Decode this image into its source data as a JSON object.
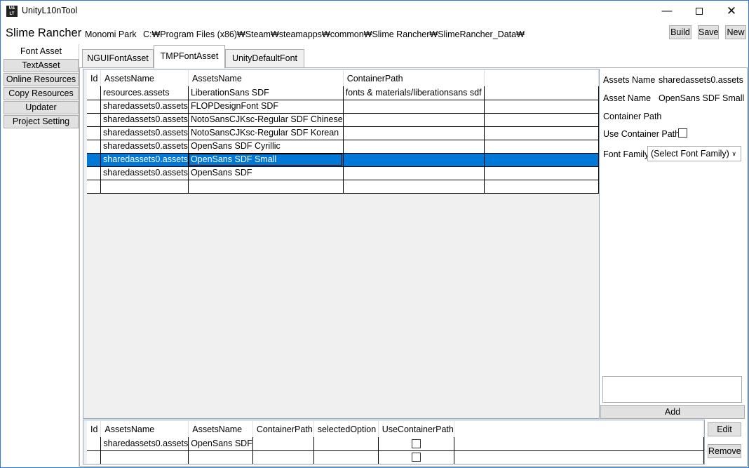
{
  "window": {
    "title": "UnityL10nTool",
    "app_icon": "unity-l10n-logo-icon",
    "controls": [
      "minimize-icon",
      "maximize-icon",
      "close-icon"
    ]
  },
  "header": {
    "game": "Slime Rancher",
    "publisher": "Monomi Park",
    "path": "C:₩Program Files (x86)₩Steam₩steamapps₩common₩Slime Rancher₩SlimeRancher_Data₩",
    "build": "Build",
    "save": "Save",
    "new": "New"
  },
  "sidebar": {
    "items": [
      {
        "label": "Font Asset",
        "selected": true
      },
      {
        "label": "TextAsset"
      },
      {
        "label": "Online Resources"
      },
      {
        "label": "Copy Resources"
      },
      {
        "label": "Updater"
      },
      {
        "label": "Project Setting"
      }
    ]
  },
  "tabs": [
    {
      "label": "NGUIFontAsset"
    },
    {
      "label": "TMPFontAsset",
      "selected": true
    },
    {
      "label": "UnityDefaultFont"
    }
  ],
  "main_grid": {
    "columns": [
      "Id",
      "AssetsName",
      "AssetsName",
      "ContainerPath",
      ""
    ],
    "rows": [
      [
        "",
        "resources.assets",
        "LiberationSans SDF",
        "fonts & materials/liberationsans sdf",
        ""
      ],
      [
        "",
        "sharedassets0.assets",
        "FLOPDesignFont SDF",
        "",
        ""
      ],
      [
        "",
        "sharedassets0.assets",
        "NotoSansCJKsc-Regular SDF Chinese",
        "",
        ""
      ],
      [
        "",
        "sharedassets0.assets",
        "NotoSansCJKsc-Regular SDF Korean",
        "",
        ""
      ],
      [
        "",
        "sharedassets0.assets",
        "OpenSans SDF Cyrillic",
        "",
        ""
      ],
      [
        "",
        "sharedassets0.assets",
        "OpenSans SDF Small",
        "",
        ""
      ],
      [
        "",
        "sharedassets0.assets",
        "OpenSans SDF",
        "",
        ""
      ],
      [
        "",
        "",
        "",
        "",
        ""
      ]
    ],
    "selected_row": 5,
    "selection_color": "#0078d7"
  },
  "detail": {
    "assets_name_label": "Assets Name",
    "assets_name_value": "sharedassets0.assets",
    "asset_name_label": "Asset Name",
    "asset_name_value": "OpenSans SDF Small",
    "container_path_label": "Container Path",
    "use_container_path_label": "Use Container Path",
    "use_container_path_checked": false,
    "font_family_label": "Font Family",
    "font_family_value": "(Select Font Family)",
    "notes_value": "",
    "add": "Add"
  },
  "bottom_grid": {
    "columns": [
      "Id",
      "AssetsName",
      "AssetsName",
      "ContainerPath",
      "selectedOption",
      "UseContainerPath",
      ""
    ],
    "rows": [
      [
        "",
        "sharedassets0.assets",
        "OpenSans SDF",
        "",
        "",
        false,
        ""
      ],
      [
        "",
        "",
        "",
        "",
        "",
        false,
        ""
      ]
    ],
    "edit": "Edit",
    "remove": "Remove"
  }
}
